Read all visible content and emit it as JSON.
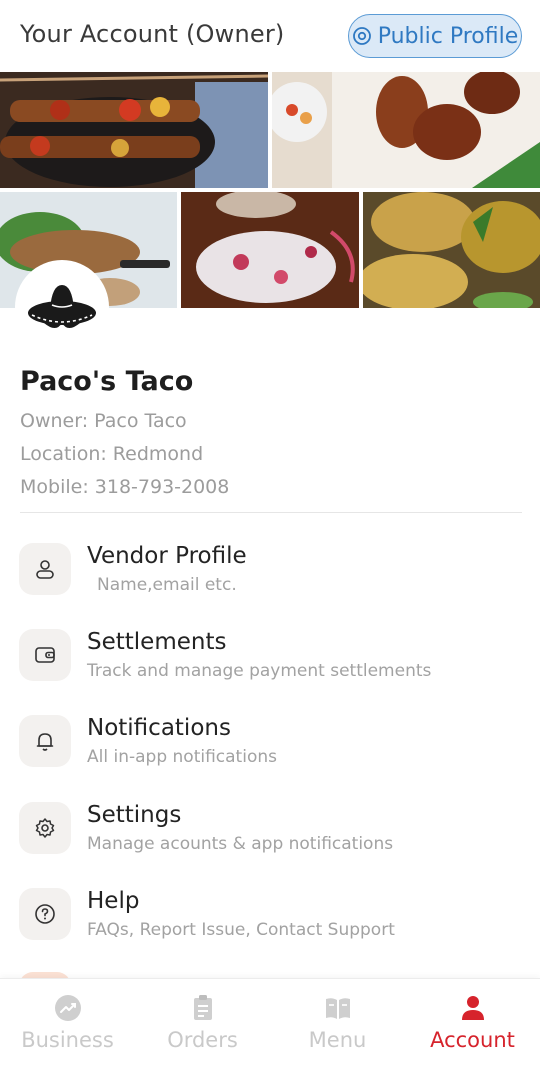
{
  "header": {
    "title": "Your Account (Owner)",
    "public_profile_label": "Public Profile"
  },
  "banner": {
    "tiles": [
      "kebab-skewers",
      "chicken-wings",
      "grilled-peppers",
      "cabbage-salad",
      "fried-patties"
    ]
  },
  "vendor": {
    "name": "Paco's Taco",
    "owner": "Owner: Paco Taco",
    "location": "Location: Redmond",
    "mobile": "Mobile: 318-793-2008",
    "logo_icon": "sombrero-icon"
  },
  "menu": [
    {
      "title": "Vendor Profile",
      "subtitle": "Name,email etc.",
      "icon": "user-icon"
    },
    {
      "title": "Settlements",
      "subtitle": "Track and manage payment settlements",
      "icon": "wallet-icon"
    },
    {
      "title": "Notifications",
      "subtitle": "All in-app notifications",
      "icon": "bell-icon"
    },
    {
      "title": "Settings",
      "subtitle": "Manage acounts & app notifications",
      "icon": "gear-icon"
    },
    {
      "title": "Help",
      "subtitle": "FAQs, Report Issue, Contact Support",
      "icon": "help-icon"
    }
  ],
  "tabs": [
    {
      "label": "Business",
      "icon": "chart-icon",
      "active": false
    },
    {
      "label": "Orders",
      "icon": "clipboard-icon",
      "active": false
    },
    {
      "label": "Menu",
      "icon": "book-icon",
      "active": false
    },
    {
      "label": "Account",
      "icon": "person-icon",
      "active": true
    }
  ],
  "colors": {
    "accent": "#d6232c",
    "link": "#2f79c2",
    "inactive": "#c9c9c9"
  }
}
